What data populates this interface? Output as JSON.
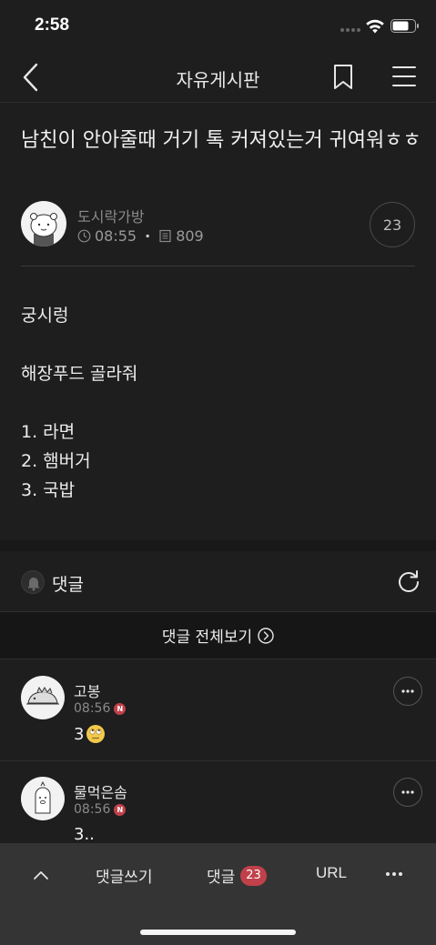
{
  "status_bar": {
    "time": "2:58"
  },
  "nav": {
    "title": "자유게시판",
    "back_icon": "chevron-left-icon",
    "bookmark_icon": "bookmark-icon",
    "menu_icon": "hamburger-menu-icon"
  },
  "post": {
    "title": "남친이 안아줄때 거기 톡 커져있는거 귀여워ㅎㅎ",
    "author": "도시락가방",
    "time": "08:55",
    "views": "809",
    "comment_count": "23",
    "body": [
      "궁시렁",
      "",
      "해장푸드 골라줘",
      "",
      "1. 라면",
      "2. 햄버거",
      "3. 국밥"
    ]
  },
  "comments_section": {
    "label": "댓글",
    "view_all": "댓글 전체보기",
    "items": [
      {
        "author": "고봉",
        "time": "08:56",
        "badge": "N",
        "text": "3",
        "emoji": "eye-roll-emoji"
      },
      {
        "author": "물먹은솜",
        "time": "08:56",
        "badge": "N",
        "text": "3.."
      }
    ]
  },
  "bottom_bar": {
    "write": "댓글쓰기",
    "comments": "댓글",
    "count": "23",
    "url": "URL"
  },
  "colors": {
    "background": "#1e1e1e",
    "badge": "#c0414a",
    "toolbar": "#343434"
  }
}
